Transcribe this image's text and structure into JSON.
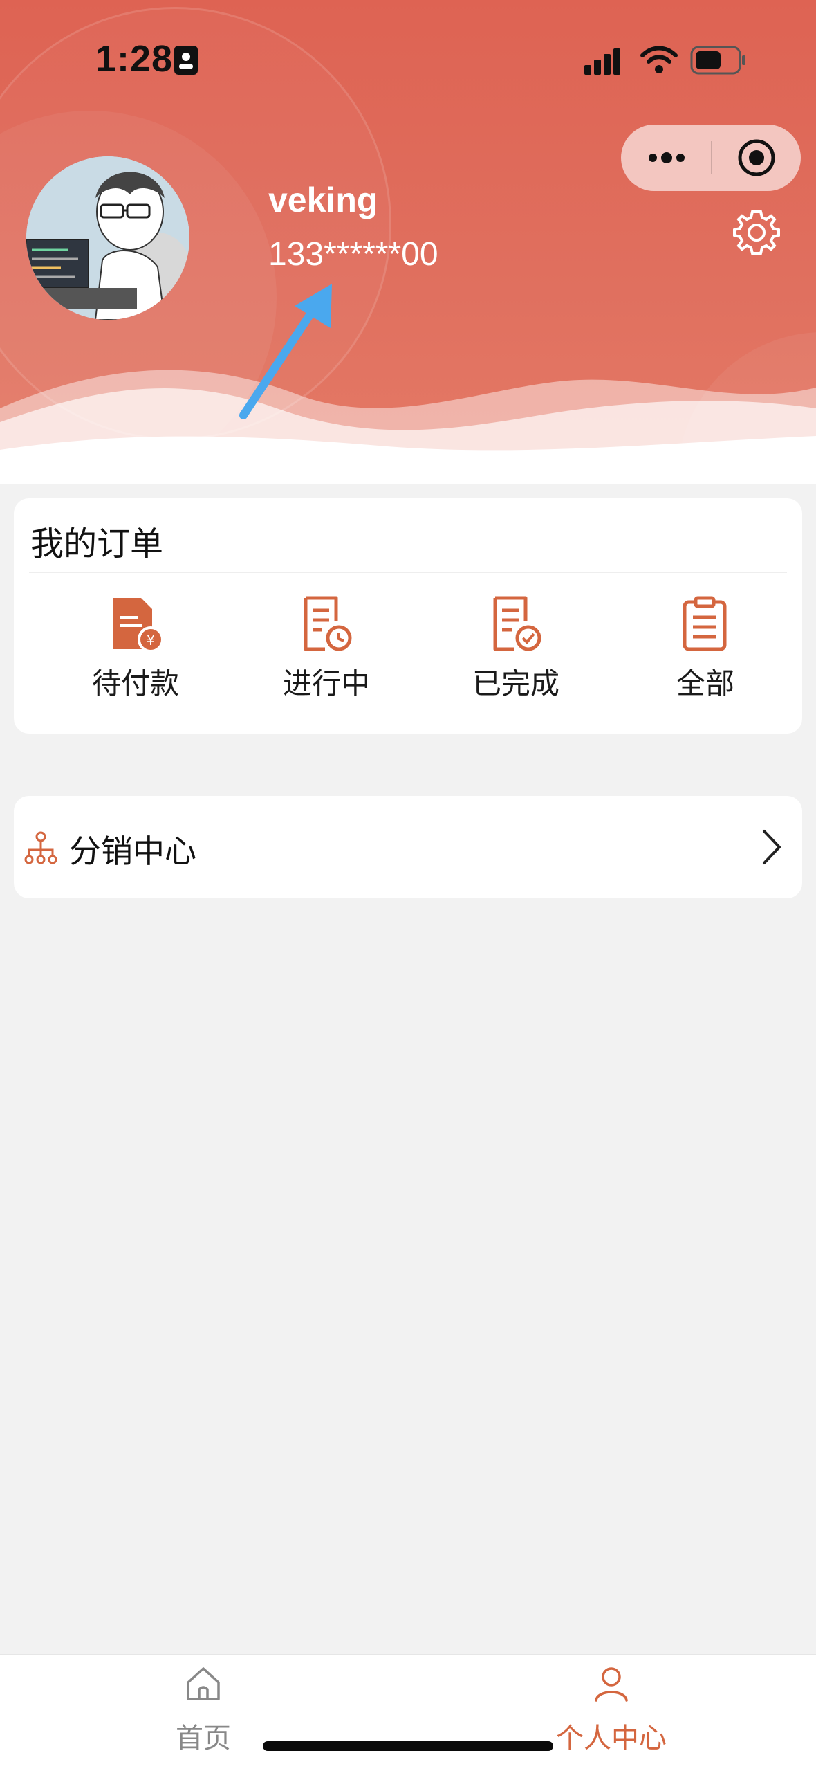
{
  "status_bar": {
    "time": "1:28"
  },
  "profile": {
    "username": "veking",
    "phone": "133******00"
  },
  "orders": {
    "title": "我的订单",
    "items": [
      {
        "label": "待付款",
        "icon": "pending-payment-icon"
      },
      {
        "label": "进行中",
        "icon": "in-progress-icon"
      },
      {
        "label": "已完成",
        "icon": "completed-icon"
      },
      {
        "label": "全部",
        "icon": "all-orders-icon"
      }
    ]
  },
  "distribution": {
    "label": "分销中心",
    "icon": "distribution-network-icon"
  },
  "tabbar": {
    "tabs": [
      {
        "label": "首页",
        "icon": "home-icon",
        "active": false
      },
      {
        "label": "个人中心",
        "icon": "user-icon",
        "active": true
      }
    ]
  },
  "colors": {
    "accent": "#d4663f",
    "header": "#df6655",
    "inactive_tab": "#888888"
  }
}
